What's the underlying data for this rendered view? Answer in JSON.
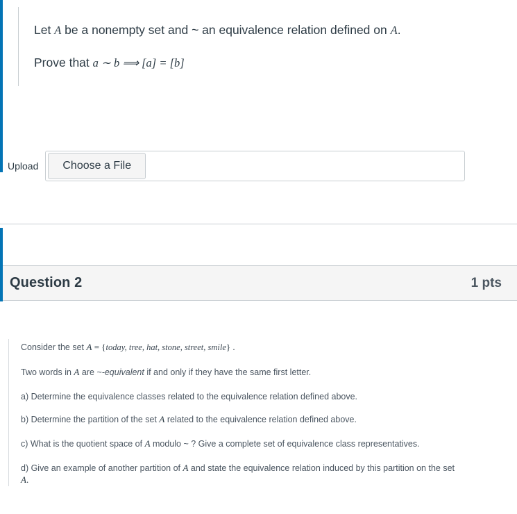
{
  "theme": {
    "accent_blue": "#0374B5",
    "header_bg": "#F5F5F5",
    "border_gray": "#C7CDD1",
    "text_color": "#2D3B45",
    "body_text_color": "#4A5560"
  },
  "question1": {
    "prompt_line1_pre": "Let ",
    "prompt_line1_math_a": "A",
    "prompt_line1_mid": " be a nonempty set and ~ an equivalence relation defined on ",
    "prompt_line1_math_b": "A",
    "prompt_line1_end": ".",
    "prompt_line2_pre": "Prove that ",
    "prompt_line2_math": "a ∼ b ⟹ [a] = [b]",
    "upload": {
      "label": "Upload",
      "choose_file_label": "Choose a File",
      "file_name_value": "",
      "file_name_placeholder": ""
    }
  },
  "question2": {
    "title": "Question 2",
    "points": "1 pts",
    "lines": {
      "l1_pre": "Consider the set ",
      "l1_math_a": "A",
      "l1_eq": " = {",
      "l1_set": "today, tree, hat, stone, street, smile",
      "l1_post": "} .",
      "l2_pre": "Two words in ",
      "l2_math_a": "A",
      "l2_mid": " are ",
      "l2_em": "~-equivalent",
      "l2_end": " if and only if they have the same first letter.",
      "l3": "a) Determine the equivalence classes related to the equivalence relation defined above.",
      "l4_pre": "b) Determine the partition of the set ",
      "l4_math_a": "A",
      "l4_end": " related to the equivalence relation defined above.",
      "l5_pre": "c) What is the quotient space of ",
      "l5_math_a": "A",
      "l5_end": " modulo ~ ? Give a complete set of equivalence class representatives.",
      "l6_pre": "d) Give an example of another partition of ",
      "l6_math_a": "A",
      "l6_end": " and state the equivalence relation induced by this partition on the set",
      "l7_math_a": "A",
      "l7_end": "."
    }
  }
}
